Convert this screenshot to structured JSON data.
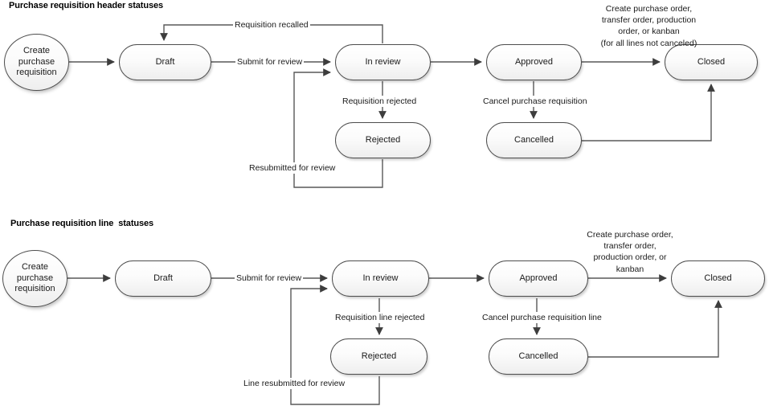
{
  "diagrams": [
    {
      "title": "Purchase requisition header statuses",
      "nodes": [
        {
          "id": "h-start",
          "label": "Create purchase\nrequisition",
          "shape": "circle"
        },
        {
          "id": "h-draft",
          "label": "Draft",
          "shape": "stadium"
        },
        {
          "id": "h-inreview",
          "label": "In review",
          "shape": "stadium"
        },
        {
          "id": "h-approved",
          "label": "Approved",
          "shape": "stadium"
        },
        {
          "id": "h-closed",
          "label": "Closed",
          "shape": "stadium"
        },
        {
          "id": "h-rejected",
          "label": "Rejected",
          "shape": "stadium"
        },
        {
          "id": "h-cancelled",
          "label": "Cancelled",
          "shape": "stadium"
        }
      ],
      "edges": [
        {
          "id": "h-e1",
          "from": "h-start",
          "to": "h-draft",
          "label": ""
        },
        {
          "id": "h-e2",
          "from": "h-draft",
          "to": "h-inreview",
          "label": "Submit for review"
        },
        {
          "id": "h-e3",
          "from": "h-inreview",
          "to": "h-draft",
          "label": "Requisition recalled"
        },
        {
          "id": "h-e4",
          "from": "h-inreview",
          "to": "h-approved",
          "label": ""
        },
        {
          "id": "h-e5",
          "from": "h-inreview",
          "to": "h-rejected",
          "label": "Requisition rejected"
        },
        {
          "id": "h-e6",
          "from": "h-rejected",
          "to": "h-inreview",
          "label": "Resubmitted for review"
        },
        {
          "id": "h-e7",
          "from": "h-approved",
          "to": "h-closed",
          "label": "Create purchase order,\ntransfer order, production\norder, or kanban\n(for all lines not canceled)"
        },
        {
          "id": "h-e8",
          "from": "h-approved",
          "to": "h-cancelled",
          "label": "Cancel purchase requisition"
        },
        {
          "id": "h-e9",
          "from": "h-cancelled",
          "to": "h-closed",
          "label": ""
        }
      ]
    },
    {
      "title": "Purchase requisition line  statuses",
      "nodes": [
        {
          "id": "l-start",
          "label": "Create purchase\nrequisition",
          "shape": "circle"
        },
        {
          "id": "l-draft",
          "label": "Draft",
          "shape": "stadium"
        },
        {
          "id": "l-inreview",
          "label": "In review",
          "shape": "stadium"
        },
        {
          "id": "l-approved",
          "label": "Approved",
          "shape": "stadium"
        },
        {
          "id": "l-closed",
          "label": "Closed",
          "shape": "stadium"
        },
        {
          "id": "l-rejected",
          "label": "Rejected",
          "shape": "stadium"
        },
        {
          "id": "l-cancelled",
          "label": "Cancelled",
          "shape": "stadium"
        }
      ],
      "edges": [
        {
          "id": "l-e1",
          "from": "l-start",
          "to": "l-draft",
          "label": ""
        },
        {
          "id": "l-e2",
          "from": "l-draft",
          "to": "l-inreview",
          "label": "Submit for review"
        },
        {
          "id": "l-e3",
          "from": "l-inreview",
          "to": "l-approved",
          "label": ""
        },
        {
          "id": "l-e4",
          "from": "l-inreview",
          "to": "l-rejected",
          "label": "Requisition line rejected"
        },
        {
          "id": "l-e5",
          "from": "l-rejected",
          "to": "l-inreview",
          "label": "Line resubmitted for review"
        },
        {
          "id": "l-e6",
          "from": "l-approved",
          "to": "l-closed",
          "label": "Create purchase order,\ntransfer order,\nproduction order, or\nkanban"
        },
        {
          "id": "l-e7",
          "from": "l-approved",
          "to": "l-cancelled",
          "label": "Cancel purchase requisition line"
        },
        {
          "id": "l-e8",
          "from": "l-cancelled",
          "to": "l-closed",
          "label": ""
        }
      ]
    }
  ],
  "colors": {
    "node_border": "#4d4d4d",
    "node_fill_top": "#ffffff",
    "node_fill_bottom": "#eeeeee",
    "connector": "#595959",
    "text": "#1a1a1a",
    "background": "#ffffff"
  }
}
